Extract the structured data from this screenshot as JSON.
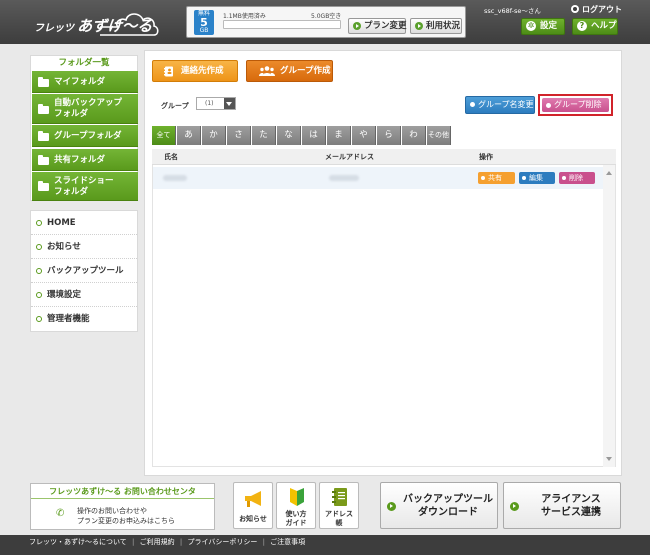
{
  "header": {
    "logo_small": "フレッツ",
    "logo_big": "あずけ〜る",
    "storage": {
      "badge_top": "無料",
      "badge_num": "5",
      "badge_unit": "GB",
      "used_text": "1.1MB使用済み",
      "free_text": "5.0GB空き",
      "used_fraction": 0.0002
    },
    "plan_change": "プラン変更",
    "usage_status": "利用状況",
    "user_name": "ssc_v68f-se〜さん",
    "logout": "ログアウト",
    "settings": "設定",
    "help": "ヘルプ",
    "colors": {
      "accent": "#5a9a1c",
      "header_bg": "#3d3d3d"
    }
  },
  "sidebar": {
    "title": "フォルダ一覧",
    "folders": [
      {
        "label": "マイフォルダ"
      },
      {
        "label1": "自動バックアップ",
        "label2": "フォルダ"
      },
      {
        "label": "グループフォルダ"
      },
      {
        "label": "共有フォルダ"
      },
      {
        "label1": "スライドショー",
        "label2": "フォルダ"
      }
    ],
    "links": [
      "HOME",
      "お知らせ",
      "バックアップツール",
      "環境設定",
      "管理者機能"
    ]
  },
  "main": {
    "contact_create": "連絡先作成",
    "group_create": "グループ作成",
    "group_label": "グループ",
    "group_value": "(1)",
    "rename_group": "グループ名変更",
    "delete_group": "グループ削除",
    "kana_tabs": [
      "全て",
      "あ",
      "か",
      "さ",
      "た",
      "な",
      "は",
      "ま",
      "や",
      "ら",
      "わ",
      "その他"
    ],
    "columns": {
      "name": "氏名",
      "email": "メールアドレス",
      "actions": "操作"
    },
    "row_actions": {
      "share": "共有",
      "edit": "編集",
      "delete": "削除"
    },
    "button_colors": {
      "orange": "#f5a030",
      "blue": "#2c7cbf",
      "pink": "#c9508d"
    }
  },
  "bottom": {
    "contact_title": "フレッツあずけ〜る お問い合わせセンタ",
    "contact_line1": "操作のお問い合わせや",
    "contact_line2": "プラン変更のお申込みはこちら",
    "tiles": {
      "notice": "お知らせ",
      "guide1": "使い方",
      "guide2": "ガイド",
      "address1": "アドレス",
      "address2": "帳"
    },
    "backup_tool1": "バックアップツール",
    "backup_tool2": "ダウンロード",
    "alliance1": "アライアンス",
    "alliance2": "サービス連携"
  },
  "footer": {
    "about": "フレッツ・あずけ〜るについて",
    "terms": "ご利用規約",
    "privacy": "プライバシーポリシー",
    "notes": "ご注意事項",
    "separator": "|"
  }
}
